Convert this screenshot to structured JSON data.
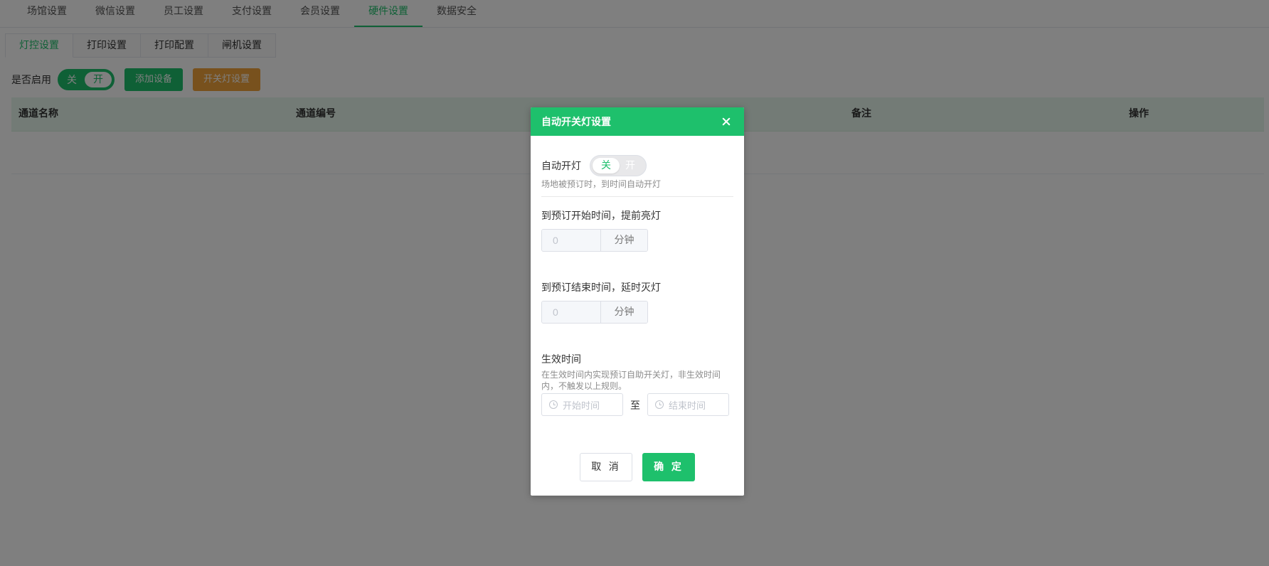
{
  "topnav": {
    "tabs": [
      {
        "label": "场馆设置"
      },
      {
        "label": "微信设置"
      },
      {
        "label": "员工设置"
      },
      {
        "label": "支付设置"
      },
      {
        "label": "会员设置"
      },
      {
        "label": "硬件设置"
      },
      {
        "label": "数据安全"
      }
    ],
    "active_index": 5
  },
  "subtabs": {
    "items": [
      {
        "label": "灯控设置"
      },
      {
        "label": "打印设置"
      },
      {
        "label": "打印配置"
      },
      {
        "label": "闸机设置"
      }
    ],
    "active_index": 0
  },
  "toolbar": {
    "enable_label": "是否启用",
    "switch_off": "关",
    "switch_on": "开",
    "switch_state": "on",
    "add_device": "添加设备",
    "light_settings": "开关灯设置"
  },
  "table": {
    "columns": [
      "通道名称",
      "通道编号",
      "",
      "备注",
      "操作"
    ],
    "rows": []
  },
  "dialog": {
    "title": "自动开关灯设置",
    "auto_light": {
      "label": "自动开灯",
      "off": "关",
      "on": "开",
      "state": "off",
      "hint": "场地被预订时，到时间自动开灯"
    },
    "before_start": {
      "label": "到预订开始时间，提前亮灯",
      "placeholder": "0",
      "unit": "分钟"
    },
    "after_end": {
      "label": "到预订结束时间，延时灭灯",
      "placeholder": "0",
      "unit": "分钟"
    },
    "effective": {
      "label": "生效时间",
      "hint_line1": "在生效时间内实现预订自助开关灯，非生效时间",
      "hint_line2": "内，不触发以上规则。",
      "start_placeholder": "开始时间",
      "separator": "至",
      "end_placeholder": "结束时间"
    },
    "cancel": "取 消",
    "confirm": "确 定"
  },
  "colors": {
    "accent": "#1ec06c",
    "warning": "#f0a23b",
    "mask": "rgba(0,0,0,0.5)"
  }
}
